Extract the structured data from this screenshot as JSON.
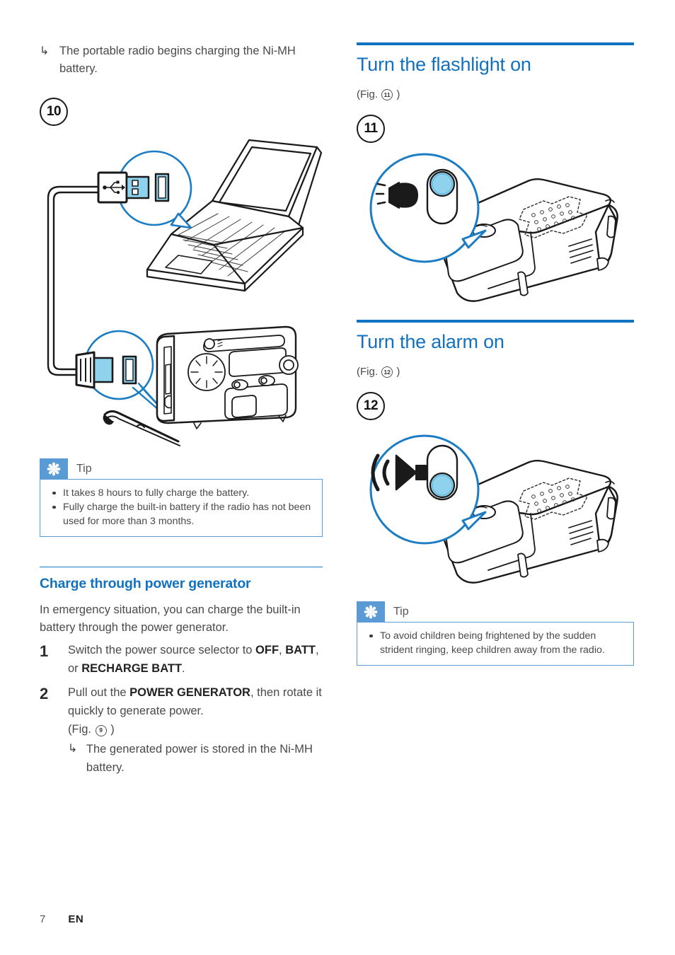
{
  "page": {
    "number": "7",
    "language": "EN"
  },
  "left_column": {
    "result_note": {
      "arrow": "↳",
      "text": "The portable radio begins charging the Ni-MH battery."
    },
    "figure_10": {
      "label": "10",
      "caption_icons": [
        "usb-plug-icon",
        "laptop-icon",
        "portable-radio-icon",
        "dc-plug-icon"
      ]
    },
    "tip": {
      "badge_icon": "asterisk-icon",
      "label": "Tip",
      "items": [
        "It takes 8 hours to fully charge the battery.",
        "Fully charge the built-in battery if the radio has not been used for more than 3 months."
      ]
    },
    "subsection": {
      "title": "Charge through power generator",
      "intro": "In emergency situation, you can charge the built-in battery through the power generator.",
      "steps": [
        {
          "number": "1",
          "segments": [
            {
              "t": "Switch the power source selector to ",
              "b": false
            },
            {
              "t": "OFF",
              "b": true
            },
            {
              "t": ", ",
              "b": false
            },
            {
              "t": "BATT",
              "b": true
            },
            {
              "t": ", or ",
              "b": false
            },
            {
              "t": "RECHARGE BATT",
              "b": true
            },
            {
              "t": ".",
              "b": false
            }
          ]
        },
        {
          "number": "2",
          "segments": [
            {
              "t": "Pull out the ",
              "b": false
            },
            {
              "t": "POWER GENERATOR",
              "b": true
            },
            {
              "t": ", then rotate it quickly to generate power.",
              "b": false
            }
          ],
          "figref_prefix": "(Fig.",
          "figref_number": "9",
          "figref_suffix": ")",
          "result": {
            "arrow": "↳",
            "text": "The generated power is stored in the Ni-MH battery."
          }
        }
      ]
    }
  },
  "right_column": {
    "section_flashlight": {
      "title": "Turn the flashlight on",
      "figref_prefix": "(Fig.",
      "figref_number": "11",
      "figref_suffix": ")",
      "figure_label": "11",
      "figure_icons": [
        "flashlight-icon",
        "power-button-icon",
        "portable-radio-icon"
      ]
    },
    "section_alarm": {
      "title": "Turn the alarm on",
      "figref_prefix": "(Fig.",
      "figref_number": "12",
      "figref_suffix": ")",
      "figure_label": "12",
      "figure_icons": [
        "siren-speaker-icon",
        "power-button-icon",
        "portable-radio-icon"
      ],
      "tip": {
        "badge_icon": "asterisk-icon",
        "label": "Tip",
        "items": [
          "To avoid children being frightened by the sudden strident ringing, keep children away from the radio."
        ]
      }
    }
  },
  "colors": {
    "heading_blue": "#1272bf",
    "rule_blue": "#0f72c0",
    "tip_badge_blue": "#5b9bd5",
    "callout_blue": "#1b7cc4",
    "highlight_cyan": "#8ed2ee",
    "ink": "#1a1a1a"
  }
}
